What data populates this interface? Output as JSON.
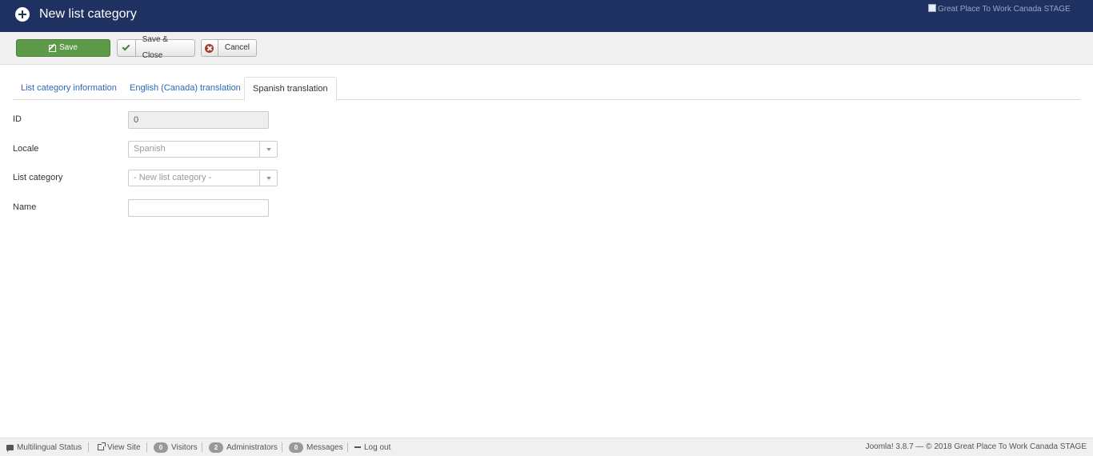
{
  "header": {
    "title": "New list category",
    "brand_alt": "Great Place To Work Canada STAGE"
  },
  "toolbar": {
    "save_label": "Save",
    "save_close_label": "Save & Close",
    "cancel_label": "Cancel"
  },
  "tabs": [
    {
      "label": "List category information",
      "active": false
    },
    {
      "label": "English (Canada) translation",
      "active": false
    },
    {
      "label": "Spanish translation",
      "active": true
    }
  ],
  "form": {
    "id": {
      "label": "ID",
      "value": "0"
    },
    "locale": {
      "label": "Locale",
      "value": "Spanish"
    },
    "list_category": {
      "label": "List category",
      "value": "- New list category -"
    },
    "name": {
      "label": "Name",
      "value": ""
    }
  },
  "footer": {
    "multilingual": "Multilingual Status",
    "view_site": "View Site",
    "visitors_count": "0",
    "visitors_label": "Visitors",
    "admins_count": "2",
    "admins_label": "Administrators",
    "messages_count": "0",
    "messages_label": "Messages",
    "logout": "Log out",
    "copyright": "Joomla! 3.8.7 — © 2018 Great Place To Work Canada STAGE"
  }
}
